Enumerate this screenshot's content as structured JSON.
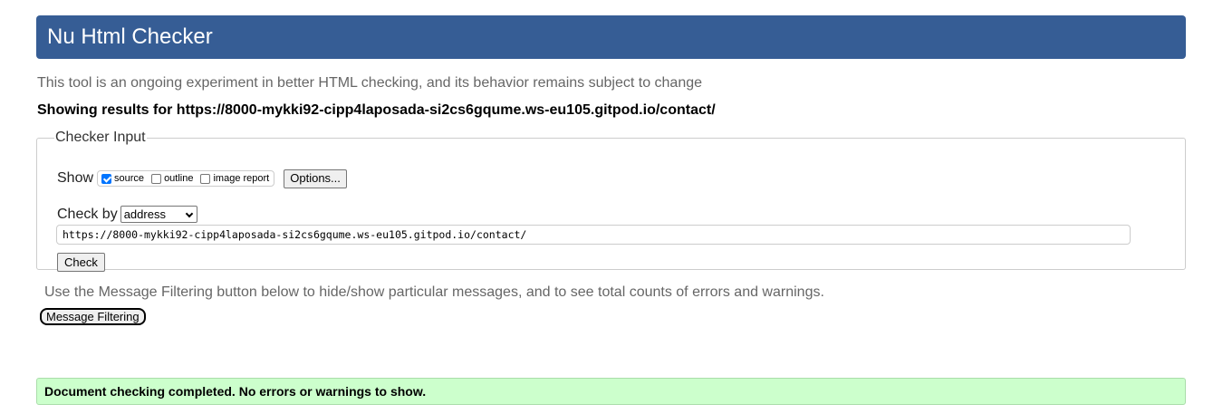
{
  "header": {
    "title": "Nu Html Checker"
  },
  "intro_text": "This tool is an ongoing experiment in better HTML checking, and its behavior remains subject to change",
  "results_for": "Showing results for https://8000-mykki92-cipp4laposada-si2cs6gqume.ws-eu105.gitpod.io/contact/",
  "checker_input": {
    "legend": "Checker Input",
    "show_label": "Show",
    "options": [
      {
        "label": "source",
        "checked": true
      },
      {
        "label": "outline",
        "checked": false
      },
      {
        "label": "image report",
        "checked": false
      }
    ],
    "options_button": "Options...",
    "check_by_label": "Check by",
    "check_by_value": "address",
    "url_value": "https://8000-mykki92-cipp4laposada-si2cs6gqume.ws-eu105.gitpod.io/contact/",
    "check_button": "Check"
  },
  "filter_note": "Use the Message Filtering button below to hide/show particular messages, and to see total counts of errors and warnings.",
  "filter_button": "Message Filtering",
  "result_message": "Document checking completed. No errors or warnings to show.",
  "colors": {
    "header_bg": "#365d95",
    "success_bg": "#ccffcc",
    "checkbox_checked": "#0075ff"
  }
}
